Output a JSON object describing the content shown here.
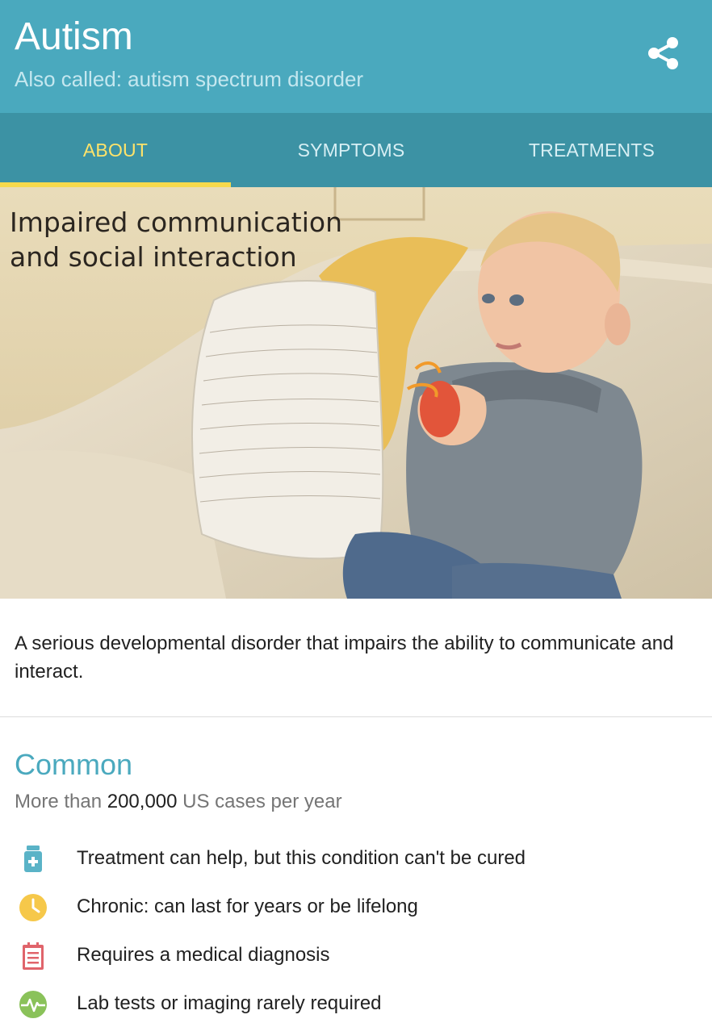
{
  "header": {
    "title": "Autism",
    "subtitle": "Also called: autism spectrum disorder",
    "share_icon": "share-icon"
  },
  "tabs": [
    {
      "label": "ABOUT",
      "active": true
    },
    {
      "label": "SYMPTOMS",
      "active": false
    },
    {
      "label": "TREATMENTS",
      "active": false
    }
  ],
  "hero": {
    "caption_line1": "Impaired communication",
    "caption_line2": "and social interaction"
  },
  "description": "A serious developmental disorder that impairs the ability to communicate and interact.",
  "prevalence": {
    "label": "Common",
    "cases_prefix": "More than",
    "cases_number": "200,000",
    "cases_suffix": "US cases per year"
  },
  "facts": [
    {
      "icon": "medicine-bottle-icon",
      "color": "#5ab3c7",
      "text": "Treatment can help, but this condition can't be cured"
    },
    {
      "icon": "clock-icon",
      "color": "#f6c84a",
      "text": "Chronic: can last for years or be lifelong"
    },
    {
      "icon": "clipboard-icon",
      "color": "#e0646b",
      "text": "Requires a medical diagnosis"
    },
    {
      "icon": "pulse-icon",
      "color": "#8ac25a",
      "text": "Lab tests or imaging rarely required"
    }
  ]
}
